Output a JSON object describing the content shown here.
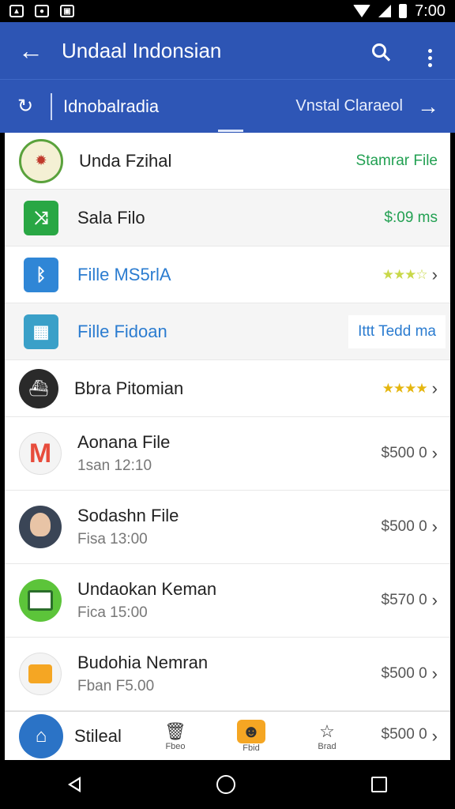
{
  "status_bar": {
    "time": "7:00",
    "icons": [
      "image-icon",
      "android-icon",
      "gallery-icon",
      "wifi-icon",
      "signal-icon",
      "battery-icon"
    ]
  },
  "app_bar": {
    "title": "Undaal Indonsian",
    "actions": [
      "search-icon",
      "more-vert-icon"
    ]
  },
  "sub_bar": {
    "label": "Idnobalradia",
    "right_text": "Vnstal Claraeol"
  },
  "colors": {
    "primary": "#2d55b4",
    "accent_green": "#22a052",
    "star_yellow": "#e5b60f",
    "link_blue": "#2b7cd0"
  },
  "items": [
    {
      "title": "Unda Fzihal",
      "trail": "Stamrar File"
    },
    {
      "title": "Sala Filo",
      "trail": "$:09 ms"
    },
    {
      "title": "Fille MS5rlA",
      "stars": "★★★☆"
    },
    {
      "title": "Fille Fidoan",
      "trail": "Ittt  Tedd ma"
    },
    {
      "title": "Bbra Pitomian",
      "stars": "★★★★"
    },
    {
      "title": "Aonana File",
      "subtitle": "1san 12:10",
      "price": "$500 0"
    },
    {
      "title": "Sodashn File",
      "subtitle": "Fisa 13:00",
      "price": "$500 0"
    },
    {
      "title": "Undaokan Keman",
      "subtitle": "Fica 15:00",
      "price": "$570 0"
    },
    {
      "title": "Budohia Nemran",
      "subtitle": "Fban F5.00",
      "price": "$500 0"
    }
  ],
  "bottom": {
    "user": "Stileal",
    "tabs": [
      "Fbeo",
      "Fbid",
      "Brad"
    ],
    "price": "$500 0"
  }
}
